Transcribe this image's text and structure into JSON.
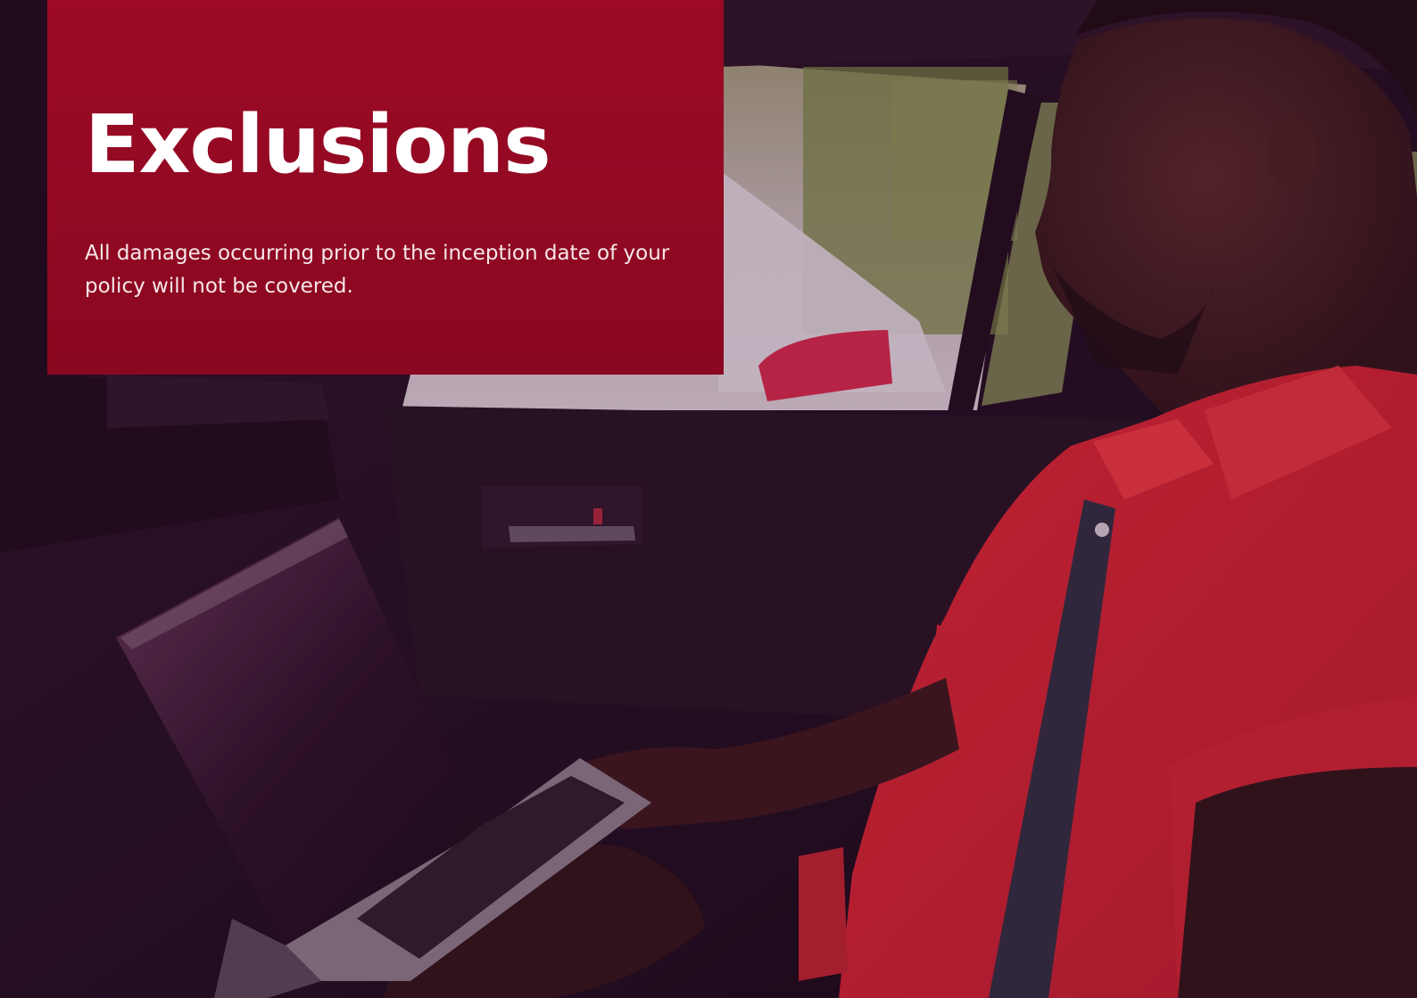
{
  "hero": {
    "title": "Exclusions",
    "description": "All damages occurring prior to the inception date of your policy will not be covered."
  },
  "photo": {
    "subject": "person-in-red-polo-using-laptop-in-car-backseat"
  },
  "colors": {
    "card_red": "#9c0a25",
    "overlay_tint": "#2a1028",
    "shirt_red": "#d8222e"
  }
}
